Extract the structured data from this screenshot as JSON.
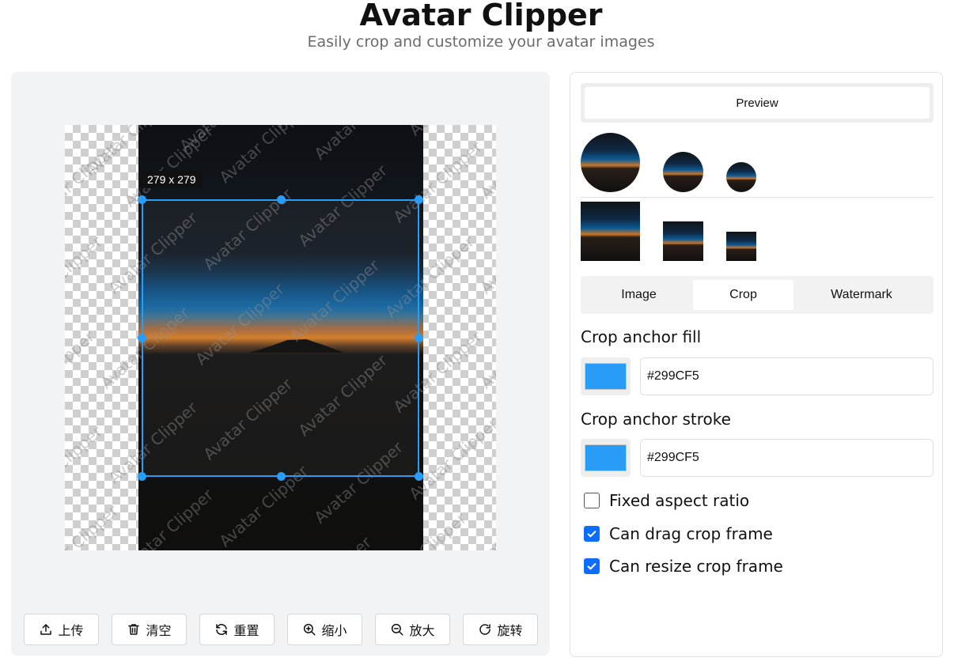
{
  "header": {
    "title": "Avatar Clipper",
    "subtitle": "Easily crop and customize your avatar images"
  },
  "canvas": {
    "watermark_text": "Avatar Clipper",
    "crop_size_label": "279 x 279"
  },
  "toolbar": {
    "upload": "上传",
    "clear": "清空",
    "reset": "重置",
    "zoom_out": "缩小",
    "zoom_in": "放大",
    "rotate": "旋转"
  },
  "panel": {
    "preview_tab": "Preview",
    "tabs": [
      {
        "label": "Image",
        "active": false
      },
      {
        "label": "Crop",
        "active": true
      },
      {
        "label": "Watermark",
        "active": false
      }
    ],
    "crop_anchor_fill": {
      "label": "Crop anchor fill",
      "value": "#299CF5",
      "color": "#299cf5"
    },
    "crop_anchor_stroke": {
      "label": "Crop anchor stroke",
      "value": "#299CF5",
      "color": "#299cf5"
    },
    "options": [
      {
        "label": "Fixed aspect ratio",
        "checked": false
      },
      {
        "label": "Can drag crop frame",
        "checked": true
      },
      {
        "label": "Can resize crop frame",
        "checked": true
      }
    ]
  }
}
